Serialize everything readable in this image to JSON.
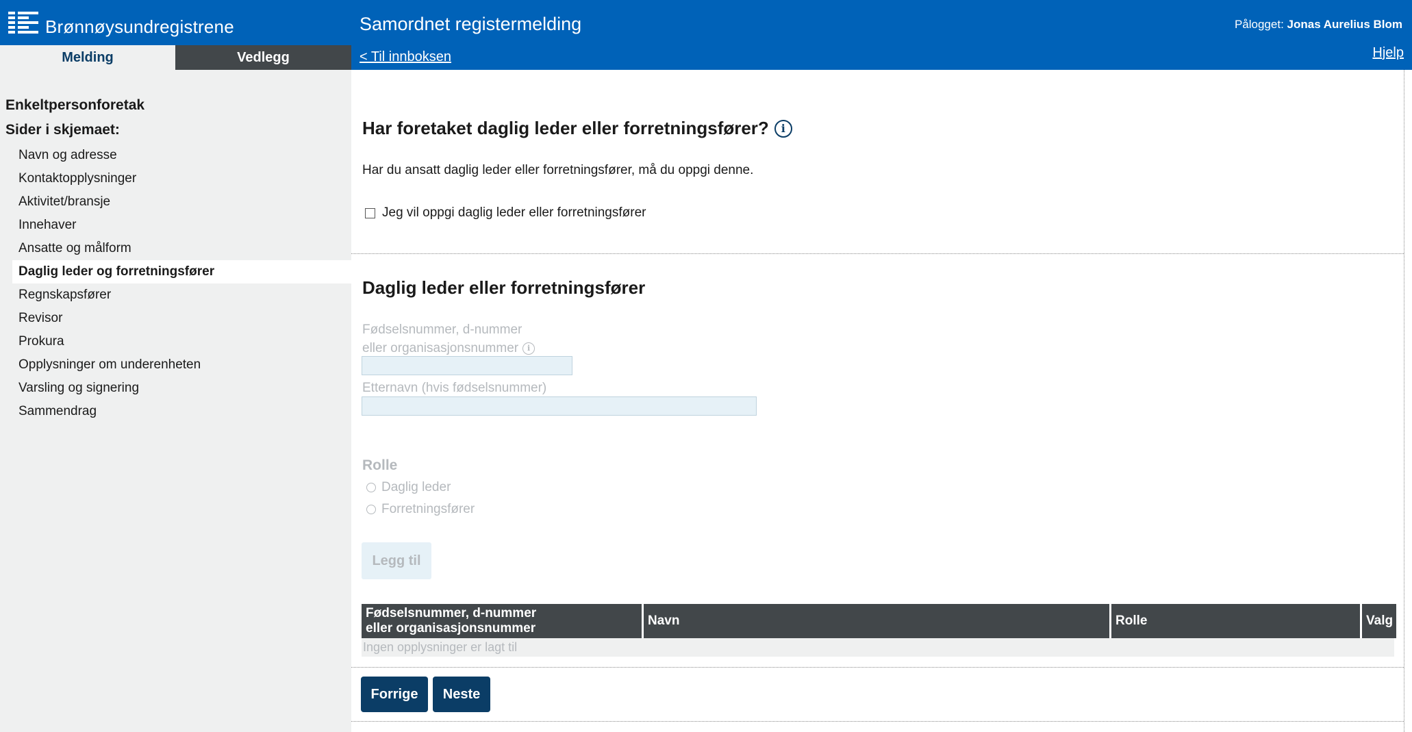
{
  "header": {
    "logo_text": "Brønnøysundregistrene",
    "app_title": "Samordnet registermelding",
    "user_prefix": "Pålogget:",
    "user_name": "Jonas Aurelius Blom",
    "back_link": "< Til innboksen",
    "help_link": "Hjelp",
    "color": "#0062b8"
  },
  "tabs": [
    {
      "label": "Melding",
      "active": true
    },
    {
      "label": "Vedlegg",
      "active": false
    }
  ],
  "sidebar": {
    "org_type": "Enkeltpersonforetak",
    "pages_heading": "Sider i skjemaet:",
    "items": [
      {
        "label": "Navn og adresse"
      },
      {
        "label": "Kontaktopplysninger"
      },
      {
        "label": "Aktivitet/bransje"
      },
      {
        "label": "Innehaver"
      },
      {
        "label": "Ansatte og målform"
      },
      {
        "label": "Daglig leder og forretningsfører",
        "active": true
      },
      {
        "label": "Regnskapsfører"
      },
      {
        "label": "Revisor"
      },
      {
        "label": "Prokura"
      },
      {
        "label": "Opplysninger om underenheten"
      },
      {
        "label": "Varsling og signering"
      },
      {
        "label": "Sammendrag"
      }
    ]
  },
  "question": {
    "title": "Har foretaket daglig leder eller forretningsfører?",
    "info_icon": "info-icon",
    "text": "Har du ansatt daglig leder eller forretningsfører, må du oppgi denne.",
    "checkbox_label": "Jeg vil oppgi daglig leder eller forretningsfører",
    "checkbox_checked": false
  },
  "form": {
    "section_title": "Daglig leder eller forretningsfører",
    "id_label_line1": "Fødselsnummer, d-nummer",
    "id_label_line2": "eller organisasjonsnummer",
    "id_value": "",
    "surname_label": "Etternavn (hvis fødselsnummer)",
    "surname_value": "",
    "role_title": "Rolle",
    "role_options": [
      {
        "label": "Daglig leder",
        "selected": false
      },
      {
        "label": "Forretningsfører",
        "selected": false
      }
    ],
    "add_button": "Legg til"
  },
  "table": {
    "col1_line1": "Fødselsnummer, d-nummer",
    "col1_line2": "eller organisasjonsnummer",
    "col2": "Navn",
    "col3": "Rolle",
    "col4": "Valg",
    "empty_text": "Ingen opplysninger er lagt til"
  },
  "nav_buttons": {
    "prev": "Forrige",
    "next": "Neste",
    "color": "#0b3d66"
  }
}
